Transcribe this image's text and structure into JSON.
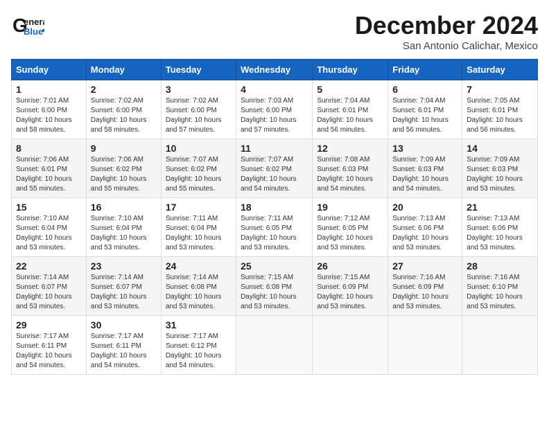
{
  "header": {
    "logo_general": "General",
    "logo_blue": "Blue",
    "month_title": "December 2024",
    "location": "San Antonio Calichar, Mexico"
  },
  "days_of_week": [
    "Sunday",
    "Monday",
    "Tuesday",
    "Wednesday",
    "Thursday",
    "Friday",
    "Saturday"
  ],
  "weeks": [
    [
      {
        "day": "1",
        "sunrise": "7:01 AM",
        "sunset": "6:00 PM",
        "daylight": "10 hours and 58 minutes."
      },
      {
        "day": "2",
        "sunrise": "7:02 AM",
        "sunset": "6:00 PM",
        "daylight": "10 hours and 58 minutes."
      },
      {
        "day": "3",
        "sunrise": "7:02 AM",
        "sunset": "6:00 PM",
        "daylight": "10 hours and 57 minutes."
      },
      {
        "day": "4",
        "sunrise": "7:03 AM",
        "sunset": "6:00 PM",
        "daylight": "10 hours and 57 minutes."
      },
      {
        "day": "5",
        "sunrise": "7:04 AM",
        "sunset": "6:01 PM",
        "daylight": "10 hours and 56 minutes."
      },
      {
        "day": "6",
        "sunrise": "7:04 AM",
        "sunset": "6:01 PM",
        "daylight": "10 hours and 56 minutes."
      },
      {
        "day": "7",
        "sunrise": "7:05 AM",
        "sunset": "6:01 PM",
        "daylight": "10 hours and 56 minutes."
      }
    ],
    [
      {
        "day": "8",
        "sunrise": "7:06 AM",
        "sunset": "6:01 PM",
        "daylight": "10 hours and 55 minutes."
      },
      {
        "day": "9",
        "sunrise": "7:06 AM",
        "sunset": "6:02 PM",
        "daylight": "10 hours and 55 minutes."
      },
      {
        "day": "10",
        "sunrise": "7:07 AM",
        "sunset": "6:02 PM",
        "daylight": "10 hours and 55 minutes."
      },
      {
        "day": "11",
        "sunrise": "7:07 AM",
        "sunset": "6:02 PM",
        "daylight": "10 hours and 54 minutes."
      },
      {
        "day": "12",
        "sunrise": "7:08 AM",
        "sunset": "6:03 PM",
        "daylight": "10 hours and 54 minutes."
      },
      {
        "day": "13",
        "sunrise": "7:09 AM",
        "sunset": "6:03 PM",
        "daylight": "10 hours and 54 minutes."
      },
      {
        "day": "14",
        "sunrise": "7:09 AM",
        "sunset": "6:03 PM",
        "daylight": "10 hours and 53 minutes."
      }
    ],
    [
      {
        "day": "15",
        "sunrise": "7:10 AM",
        "sunset": "6:04 PM",
        "daylight": "10 hours and 53 minutes."
      },
      {
        "day": "16",
        "sunrise": "7:10 AM",
        "sunset": "6:04 PM",
        "daylight": "10 hours and 53 minutes."
      },
      {
        "day": "17",
        "sunrise": "7:11 AM",
        "sunset": "6:04 PM",
        "daylight": "10 hours and 53 minutes."
      },
      {
        "day": "18",
        "sunrise": "7:11 AM",
        "sunset": "6:05 PM",
        "daylight": "10 hours and 53 minutes."
      },
      {
        "day": "19",
        "sunrise": "7:12 AM",
        "sunset": "6:05 PM",
        "daylight": "10 hours and 53 minutes."
      },
      {
        "day": "20",
        "sunrise": "7:13 AM",
        "sunset": "6:06 PM",
        "daylight": "10 hours and 53 minutes."
      },
      {
        "day": "21",
        "sunrise": "7:13 AM",
        "sunset": "6:06 PM",
        "daylight": "10 hours and 53 minutes."
      }
    ],
    [
      {
        "day": "22",
        "sunrise": "7:14 AM",
        "sunset": "6:07 PM",
        "daylight": "10 hours and 53 minutes."
      },
      {
        "day": "23",
        "sunrise": "7:14 AM",
        "sunset": "6:07 PM",
        "daylight": "10 hours and 53 minutes."
      },
      {
        "day": "24",
        "sunrise": "7:14 AM",
        "sunset": "6:08 PM",
        "daylight": "10 hours and 53 minutes."
      },
      {
        "day": "25",
        "sunrise": "7:15 AM",
        "sunset": "6:08 PM",
        "daylight": "10 hours and 53 minutes."
      },
      {
        "day": "26",
        "sunrise": "7:15 AM",
        "sunset": "6:09 PM",
        "daylight": "10 hours and 53 minutes."
      },
      {
        "day": "27",
        "sunrise": "7:16 AM",
        "sunset": "6:09 PM",
        "daylight": "10 hours and 53 minutes."
      },
      {
        "day": "28",
        "sunrise": "7:16 AM",
        "sunset": "6:10 PM",
        "daylight": "10 hours and 53 minutes."
      }
    ],
    [
      {
        "day": "29",
        "sunrise": "7:17 AM",
        "sunset": "6:11 PM",
        "daylight": "10 hours and 54 minutes."
      },
      {
        "day": "30",
        "sunrise": "7:17 AM",
        "sunset": "6:11 PM",
        "daylight": "10 hours and 54 minutes."
      },
      {
        "day": "31",
        "sunrise": "7:17 AM",
        "sunset": "6:12 PM",
        "daylight": "10 hours and 54 minutes."
      },
      null,
      null,
      null,
      null
    ]
  ]
}
